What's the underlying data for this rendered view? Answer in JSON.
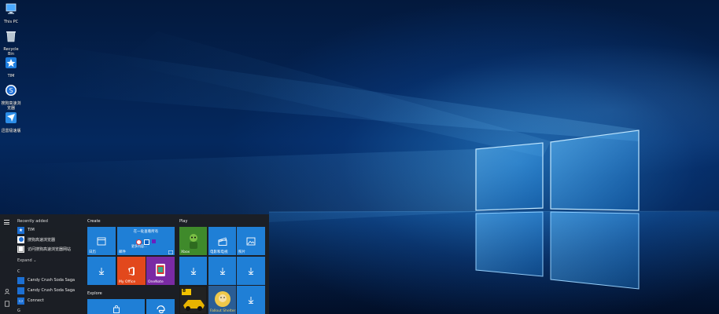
{
  "desktop": {
    "icons": [
      {
        "label": "This PC",
        "icon": "computer-icon"
      },
      {
        "label": "Recycle Bin",
        "icon": "recycle-bin-icon"
      },
      {
        "label": "TIM",
        "icon": "tim-icon"
      },
      {
        "label": "搜狗高速浏览器",
        "icon": "sogou-browser-icon"
      },
      {
        "label": "迅雷极速版",
        "icon": "thunder-icon"
      }
    ]
  },
  "start_menu": {
    "recently_added_header": "Recently added",
    "recent_apps": [
      {
        "label": "TIM",
        "icon": "tim-icon"
      },
      {
        "label": "搜狗高速浏览器",
        "icon": "sogou-browser-icon"
      },
      {
        "label": "访问搜狗高速浏览器网站",
        "icon": "sogou-website-icon"
      }
    ],
    "expand_label": "Expand ⌄",
    "letter_c": "C",
    "c_apps": [
      {
        "label": "Candy Crush Soda Saga",
        "icon": "candy-crush-icon"
      },
      {
        "label": "Candy Crush Soda Saga",
        "icon": "candy-crush-icon"
      },
      {
        "label": "Connect",
        "icon": "connect-icon"
      }
    ],
    "letter_g": "G",
    "groups": {
      "create": "Create",
      "play": "Play",
      "explore": "Explore"
    },
    "tiles": {
      "calendar_label": "日历",
      "mail_top": "在一处查看所有",
      "mail_sub": "邮件",
      "mail_hint": "更多内容...",
      "office_label": "My Office",
      "onenote_label": "OneNote",
      "xbox_label": "Xbox",
      "movies_label": "电影和电视",
      "photos_label": "照片",
      "asphalt_label": "8",
      "fallout_label": "Fallout Shelter"
    }
  }
}
